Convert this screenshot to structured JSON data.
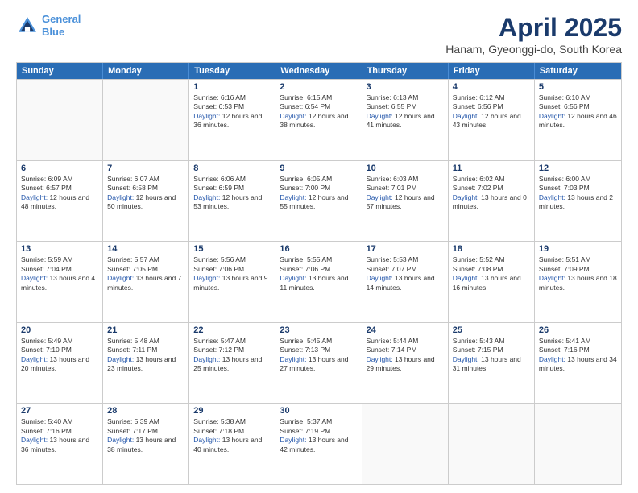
{
  "header": {
    "logo_line1": "General",
    "logo_line2": "Blue",
    "month": "April 2025",
    "location": "Hanam, Gyeonggi-do, South Korea"
  },
  "weekdays": [
    "Sunday",
    "Monday",
    "Tuesday",
    "Wednesday",
    "Thursday",
    "Friday",
    "Saturday"
  ],
  "rows": [
    [
      {
        "day": "",
        "sunrise": "",
        "sunset": "",
        "daylight": ""
      },
      {
        "day": "",
        "sunrise": "",
        "sunset": "",
        "daylight": ""
      },
      {
        "day": "1",
        "sunrise": "Sunrise: 6:16 AM",
        "sunset": "Sunset: 6:53 PM",
        "daylight": "Daylight: 12 hours and 36 minutes."
      },
      {
        "day": "2",
        "sunrise": "Sunrise: 6:15 AM",
        "sunset": "Sunset: 6:54 PM",
        "daylight": "Daylight: 12 hours and 38 minutes."
      },
      {
        "day": "3",
        "sunrise": "Sunrise: 6:13 AM",
        "sunset": "Sunset: 6:55 PM",
        "daylight": "Daylight: 12 hours and 41 minutes."
      },
      {
        "day": "4",
        "sunrise": "Sunrise: 6:12 AM",
        "sunset": "Sunset: 6:56 PM",
        "daylight": "Daylight: 12 hours and 43 minutes."
      },
      {
        "day": "5",
        "sunrise": "Sunrise: 6:10 AM",
        "sunset": "Sunset: 6:56 PM",
        "daylight": "Daylight: 12 hours and 46 minutes."
      }
    ],
    [
      {
        "day": "6",
        "sunrise": "Sunrise: 6:09 AM",
        "sunset": "Sunset: 6:57 PM",
        "daylight": "Daylight: 12 hours and 48 minutes."
      },
      {
        "day": "7",
        "sunrise": "Sunrise: 6:07 AM",
        "sunset": "Sunset: 6:58 PM",
        "daylight": "Daylight: 12 hours and 50 minutes."
      },
      {
        "day": "8",
        "sunrise": "Sunrise: 6:06 AM",
        "sunset": "Sunset: 6:59 PM",
        "daylight": "Daylight: 12 hours and 53 minutes."
      },
      {
        "day": "9",
        "sunrise": "Sunrise: 6:05 AM",
        "sunset": "Sunset: 7:00 PM",
        "daylight": "Daylight: 12 hours and 55 minutes."
      },
      {
        "day": "10",
        "sunrise": "Sunrise: 6:03 AM",
        "sunset": "Sunset: 7:01 PM",
        "daylight": "Daylight: 12 hours and 57 minutes."
      },
      {
        "day": "11",
        "sunrise": "Sunrise: 6:02 AM",
        "sunset": "Sunset: 7:02 PM",
        "daylight": "Daylight: 13 hours and 0 minutes."
      },
      {
        "day": "12",
        "sunrise": "Sunrise: 6:00 AM",
        "sunset": "Sunset: 7:03 PM",
        "daylight": "Daylight: 13 hours and 2 minutes."
      }
    ],
    [
      {
        "day": "13",
        "sunrise": "Sunrise: 5:59 AM",
        "sunset": "Sunset: 7:04 PM",
        "daylight": "Daylight: 13 hours and 4 minutes."
      },
      {
        "day": "14",
        "sunrise": "Sunrise: 5:57 AM",
        "sunset": "Sunset: 7:05 PM",
        "daylight": "Daylight: 13 hours and 7 minutes."
      },
      {
        "day": "15",
        "sunrise": "Sunrise: 5:56 AM",
        "sunset": "Sunset: 7:06 PM",
        "daylight": "Daylight: 13 hours and 9 minutes."
      },
      {
        "day": "16",
        "sunrise": "Sunrise: 5:55 AM",
        "sunset": "Sunset: 7:06 PM",
        "daylight": "Daylight: 13 hours and 11 minutes."
      },
      {
        "day": "17",
        "sunrise": "Sunrise: 5:53 AM",
        "sunset": "Sunset: 7:07 PM",
        "daylight": "Daylight: 13 hours and 14 minutes."
      },
      {
        "day": "18",
        "sunrise": "Sunrise: 5:52 AM",
        "sunset": "Sunset: 7:08 PM",
        "daylight": "Daylight: 13 hours and 16 minutes."
      },
      {
        "day": "19",
        "sunrise": "Sunrise: 5:51 AM",
        "sunset": "Sunset: 7:09 PM",
        "daylight": "Daylight: 13 hours and 18 minutes."
      }
    ],
    [
      {
        "day": "20",
        "sunrise": "Sunrise: 5:49 AM",
        "sunset": "Sunset: 7:10 PM",
        "daylight": "Daylight: 13 hours and 20 minutes."
      },
      {
        "day": "21",
        "sunrise": "Sunrise: 5:48 AM",
        "sunset": "Sunset: 7:11 PM",
        "daylight": "Daylight: 13 hours and 23 minutes."
      },
      {
        "day": "22",
        "sunrise": "Sunrise: 5:47 AM",
        "sunset": "Sunset: 7:12 PM",
        "daylight": "Daylight: 13 hours and 25 minutes."
      },
      {
        "day": "23",
        "sunrise": "Sunrise: 5:45 AM",
        "sunset": "Sunset: 7:13 PM",
        "daylight": "Daylight: 13 hours and 27 minutes."
      },
      {
        "day": "24",
        "sunrise": "Sunrise: 5:44 AM",
        "sunset": "Sunset: 7:14 PM",
        "daylight": "Daylight: 13 hours and 29 minutes."
      },
      {
        "day": "25",
        "sunrise": "Sunrise: 5:43 AM",
        "sunset": "Sunset: 7:15 PM",
        "daylight": "Daylight: 13 hours and 31 minutes."
      },
      {
        "day": "26",
        "sunrise": "Sunrise: 5:41 AM",
        "sunset": "Sunset: 7:16 PM",
        "daylight": "Daylight: 13 hours and 34 minutes."
      }
    ],
    [
      {
        "day": "27",
        "sunrise": "Sunrise: 5:40 AM",
        "sunset": "Sunset: 7:16 PM",
        "daylight": "Daylight: 13 hours and 36 minutes."
      },
      {
        "day": "28",
        "sunrise": "Sunrise: 5:39 AM",
        "sunset": "Sunset: 7:17 PM",
        "daylight": "Daylight: 13 hours and 38 minutes."
      },
      {
        "day": "29",
        "sunrise": "Sunrise: 5:38 AM",
        "sunset": "Sunset: 7:18 PM",
        "daylight": "Daylight: 13 hours and 40 minutes."
      },
      {
        "day": "30",
        "sunrise": "Sunrise: 5:37 AM",
        "sunset": "Sunset: 7:19 PM",
        "daylight": "Daylight: 13 hours and 42 minutes."
      },
      {
        "day": "",
        "sunrise": "",
        "sunset": "",
        "daylight": ""
      },
      {
        "day": "",
        "sunrise": "",
        "sunset": "",
        "daylight": ""
      },
      {
        "day": "",
        "sunrise": "",
        "sunset": "",
        "daylight": ""
      }
    ]
  ]
}
